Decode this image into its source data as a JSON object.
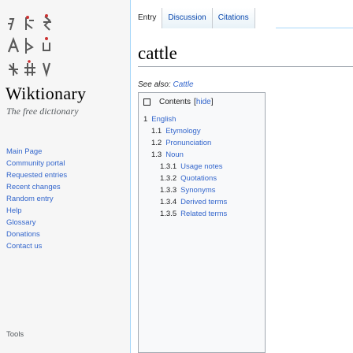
{
  "site": {
    "wordmark": "Wiktionary",
    "tagline": "The free dictionary"
  },
  "sidebar": {
    "items": [
      {
        "label": "Main Page"
      },
      {
        "label": "Community portal"
      },
      {
        "label": "Requested entries"
      },
      {
        "label": "Recent changes"
      },
      {
        "label": "Random entry"
      },
      {
        "label": "Help"
      },
      {
        "label": "Glossary"
      },
      {
        "label": "Donations"
      },
      {
        "label": "Contact us"
      }
    ],
    "tools_heading": "Tools"
  },
  "tabs": [
    {
      "label": "Entry"
    },
    {
      "label": "Discussion"
    },
    {
      "label": "Citations"
    }
  ],
  "page": {
    "title": "cattle",
    "see_also_prefix": "See also: ",
    "see_also_link": "Cattle"
  },
  "toc": {
    "title": "Contents",
    "hide_open": "[",
    "hide_label": "hide",
    "hide_close": "]",
    "items": [
      {
        "num": "1",
        "text": "English"
      },
      {
        "num": "1.1",
        "text": "Etymology"
      },
      {
        "num": "1.2",
        "text": "Pronunciation"
      },
      {
        "num": "1.3",
        "text": "Noun"
      },
      {
        "num": "1.3.1",
        "text": "Usage notes"
      },
      {
        "num": "1.3.2",
        "text": "Quotations"
      },
      {
        "num": "1.3.3",
        "text": "Synonyms"
      },
      {
        "num": "1.3.4",
        "text": "Derived terms"
      },
      {
        "num": "1.3.5",
        "text": "Related terms"
      }
    ]
  },
  "colors": {
    "link": "#3366cc",
    "tab_border": "#a7d7f9",
    "toc_bg": "#f8f9fa"
  }
}
